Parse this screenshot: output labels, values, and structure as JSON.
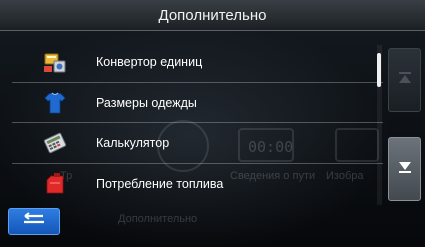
{
  "header": {
    "title": "Дополнительно"
  },
  "menu": {
    "items": [
      {
        "label": "Конвертор единиц",
        "icon": "unit-converter-icon"
      },
      {
        "label": "Размеры одежды",
        "icon": "clothing-sizes-icon"
      },
      {
        "label": "Калькулятор",
        "icon": "calculator-icon"
      },
      {
        "label": "Потребление топлива",
        "icon": "fuel-consumption-icon"
      }
    ]
  },
  "background": {
    "left_label": "Тр",
    "mid_label": "Сведения о пути",
    "right_label": "Изобра",
    "bottom_label": "Дополнительно",
    "clock": "00:00"
  },
  "colors": {
    "accent": "#1e6ad0",
    "header_bg": "#2a2f34",
    "scroll_down_bg": "#5a6066"
  }
}
